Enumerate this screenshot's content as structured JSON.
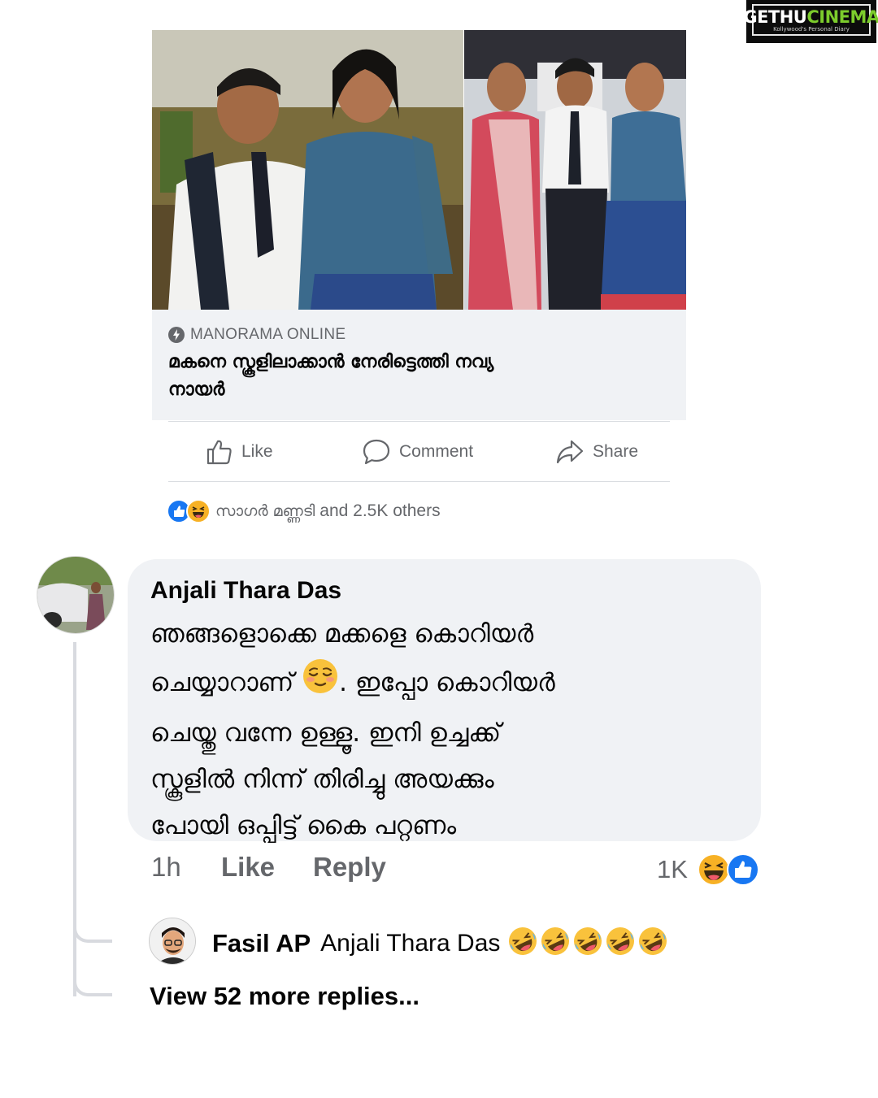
{
  "watermark": {
    "brand_a": "GETHU",
    "brand_b": "CINEMA",
    "tagline": "Kollywood's Personal Diary"
  },
  "post": {
    "info_badge": "i",
    "source": "MANORAMA ONLINE",
    "headline_line1": "മകനെ സ്കൂളിലാക്കാൻ നേരിട്ടെത്തി നവ്യ",
    "headline_line2": "നായർ",
    "actions": {
      "like": "Like",
      "comment": "Comment",
      "share": "Share"
    },
    "reactions": {
      "icons": [
        "like-icon",
        "haha-icon"
      ],
      "name": "സാഗർ മണ്ണടി",
      "rest": "and 2.5K others"
    }
  },
  "comment": {
    "author": "Anjali Thara Das",
    "line1": "ഞങ്ങളൊക്കെ മക്കളെ കൊറിയർ",
    "line2_a": "ചെയ്യാറാണ്",
    "line2_b": ". ഇപ്പോ കൊറിയർ",
    "line3": "ചെയ്തു വന്നേ ഉള്ളൂ. ഇനി ഉച്ചക്ക്",
    "line4": "സ്കൂളിൽ നിന്ന് തിരിച്ചു അയക്കും",
    "line5": "പോയി ഒപ്പിട്ട് കൈ പറ്റണം",
    "time": "1h",
    "like": "Like",
    "reply": "Reply",
    "reaction_count": "1K",
    "reaction_icons": [
      "haha-icon",
      "like-icon"
    ]
  },
  "reply": {
    "author": "Fasil AP",
    "mention": "Anjali Thara Das",
    "emojis": [
      "rofl-icon",
      "rofl-icon",
      "rofl-icon",
      "rofl-icon",
      "rofl-icon"
    ]
  },
  "view_more": "View 52 more replies...",
  "colors": {
    "facebook_blue": "#1877f2",
    "secondary_text": "#65676b",
    "bubble_bg": "#f0f2f5",
    "emoji_yellow": "#f7b125",
    "watermark_green": "#7ccc2c"
  }
}
